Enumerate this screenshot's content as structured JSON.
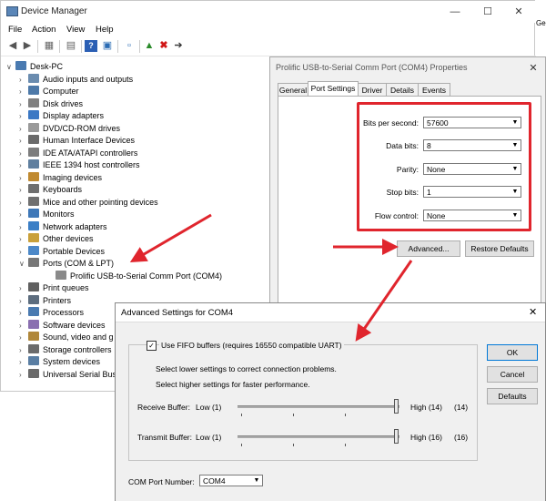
{
  "device_manager": {
    "title": "Device Manager",
    "menu": [
      "File",
      "Action",
      "View",
      "Help"
    ],
    "root": "Desk-PC",
    "items": [
      "Audio inputs and outputs",
      "Computer",
      "Disk drives",
      "Display adapters",
      "DVD/CD-ROM drives",
      "Human Interface Devices",
      "IDE ATA/ATAPI controllers",
      "IEEE 1394 host controllers",
      "Imaging devices",
      "Keyboards",
      "Mice and other pointing devices",
      "Monitors",
      "Network adapters",
      "Other devices",
      "Portable Devices",
      "Ports (COM & LPT)",
      "Prolific USB-to-Serial Comm Port (COM4)",
      "Print queues",
      "Printers",
      "Processors",
      "Software devices",
      "Sound, video and g",
      "Storage controllers",
      "System devices",
      "Universal Serial Bus"
    ],
    "item_icon_colors": [
      "#6a8caf",
      "#4d79a8",
      "#808080",
      "#3b78c4",
      "#9a9a9a",
      "#6a6a6a",
      "#7d7d7d",
      "#5f7f9f",
      "#c08a30",
      "#6f6f6f",
      "#707070",
      "#3e78b8",
      "#3b7fc6",
      "#c9a03a",
      "#4c88c8",
      "#777777",
      "#8a8a8a",
      "#606060",
      "#5d6d7e",
      "#4a7ab0",
      "#8a6fb0",
      "#b0873a",
      "#6b6b6b",
      "#5a7ea3",
      "#6a6a6a"
    ],
    "edge_text": "Ge"
  },
  "properties": {
    "title": "Prolific USB-to-Serial Comm Port (COM4) Properties",
    "tabs": [
      "General",
      "Port Settings",
      "Driver",
      "Details",
      "Events"
    ],
    "fields": [
      {
        "label": "Bits per second:",
        "value": "57600"
      },
      {
        "label": "Data bits:",
        "value": "8"
      },
      {
        "label": "Parity:",
        "value": "None"
      },
      {
        "label": "Stop bits:",
        "value": "1"
      },
      {
        "label": "Flow control:",
        "value": "None"
      }
    ],
    "advanced_button": "Advanced...",
    "restore_button": "Restore Defaults"
  },
  "advanced": {
    "title": "Advanced Settings for COM4",
    "fifo_label": "Use FIFO buffers (requires 16550 compatible UART)",
    "hint1": "Select lower settings to correct connection problems.",
    "hint2": "Select higher settings for faster performance.",
    "receive": {
      "label": "Receive Buffer:",
      "low": "Low (1)",
      "high": "High (14)",
      "value": "(14)",
      "level": 1.0
    },
    "transmit": {
      "label": "Transmit Buffer:",
      "low": "Low (1)",
      "high": "High (16)",
      "value": "(16)",
      "level": 1.0
    },
    "com_label": "COM Port Number:",
    "com_value": "COM4",
    "ok": "OK",
    "cancel": "Cancel",
    "defaults": "Defaults"
  },
  "colors": {
    "annotation_red": "#e0252d"
  }
}
